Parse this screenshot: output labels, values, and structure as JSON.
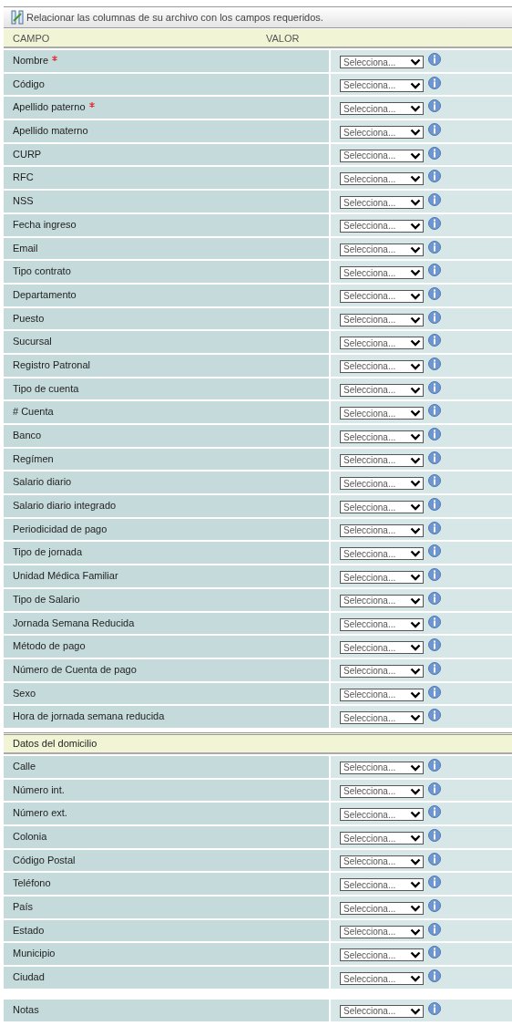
{
  "header": {
    "title": "Relacionar las columnas de su archivo con los campos requeridos."
  },
  "columns": [
    "CAMPO",
    "VALOR"
  ],
  "fields": [
    {
      "label": "Nombre",
      "required": true,
      "value": "Selecciona..."
    },
    {
      "label": "Código",
      "required": false,
      "value": "Selecciona..."
    },
    {
      "label": "Apellido paterno",
      "required": true,
      "value": "Selecciona..."
    },
    {
      "label": "Apellido materno",
      "required": false,
      "value": "Selecciona..."
    },
    {
      "label": "CURP",
      "required": false,
      "value": "Selecciona..."
    },
    {
      "label": "RFC",
      "required": false,
      "value": "Selecciona..."
    },
    {
      "label": "NSS",
      "required": false,
      "value": "Selecciona..."
    },
    {
      "label": "Fecha ingreso",
      "required": false,
      "value": "Selecciona..."
    },
    {
      "label": "Email",
      "required": false,
      "value": "Selecciona..."
    },
    {
      "label": "Tipo contrato",
      "required": false,
      "value": "Selecciona..."
    },
    {
      "label": "Departamento",
      "required": false,
      "value": "Selecciona..."
    },
    {
      "label": "Puesto",
      "required": false,
      "value": "Selecciona..."
    },
    {
      "label": "Sucursal",
      "required": false,
      "value": "Selecciona..."
    },
    {
      "label": "Registro Patronal",
      "required": false,
      "value": "Selecciona..."
    },
    {
      "label": "Tipo de cuenta",
      "required": false,
      "value": "Selecciona..."
    },
    {
      "label": "# Cuenta",
      "required": false,
      "value": "Selecciona..."
    },
    {
      "label": "Banco",
      "required": false,
      "value": "Selecciona..."
    },
    {
      "label": "Regímen",
      "required": false,
      "value": "Selecciona..."
    },
    {
      "label": "Salario diario",
      "required": false,
      "value": "Selecciona..."
    },
    {
      "label": "Salario diario integrado",
      "required": false,
      "value": "Selecciona..."
    },
    {
      "label": "Periodicidad de pago",
      "required": false,
      "value": "Selecciona..."
    },
    {
      "label": "Tipo de jornada",
      "required": false,
      "value": "Selecciona..."
    },
    {
      "label": "Unidad Médica Familiar",
      "required": false,
      "value": "Selecciona..."
    },
    {
      "label": "Tipo de Salario",
      "required": false,
      "value": "Selecciona..."
    },
    {
      "label": "Jornada Semana Reducida",
      "required": false,
      "value": "Selecciona..."
    },
    {
      "label": "Método de pago",
      "required": false,
      "value": "Selecciona..."
    },
    {
      "label": "Número de Cuenta de pago",
      "required": false,
      "value": "Selecciona..."
    },
    {
      "label": "Sexo",
      "required": false,
      "value": "Selecciona..."
    },
    {
      "label": "Hora de jornada semana reducida",
      "required": false,
      "value": "Selecciona..."
    }
  ],
  "address_section": {
    "title": "Datos del domicilio",
    "fields": [
      {
        "label": "Calle",
        "required": false,
        "value": "Selecciona..."
      },
      {
        "label": "Número int.",
        "required": false,
        "value": "Selecciona..."
      },
      {
        "label": "Número ext.",
        "required": false,
        "value": "Selecciona..."
      },
      {
        "label": "Colonia",
        "required": false,
        "value": "Selecciona..."
      },
      {
        "label": "Código Postal",
        "required": false,
        "value": "Selecciona..."
      },
      {
        "label": "Teléfono",
        "required": false,
        "value": "Selecciona..."
      },
      {
        "label": "País",
        "required": false,
        "value": "Selecciona..."
      },
      {
        "label": "Estado",
        "required": false,
        "value": "Selecciona..."
      },
      {
        "label": "Municipio",
        "required": false,
        "value": "Selecciona..."
      },
      {
        "label": "Ciudad",
        "required": false,
        "value": "Selecciona..."
      }
    ]
  },
  "notes": [
    {
      "label": "Notas",
      "required": false,
      "value": "Selecciona..."
    }
  ]
}
